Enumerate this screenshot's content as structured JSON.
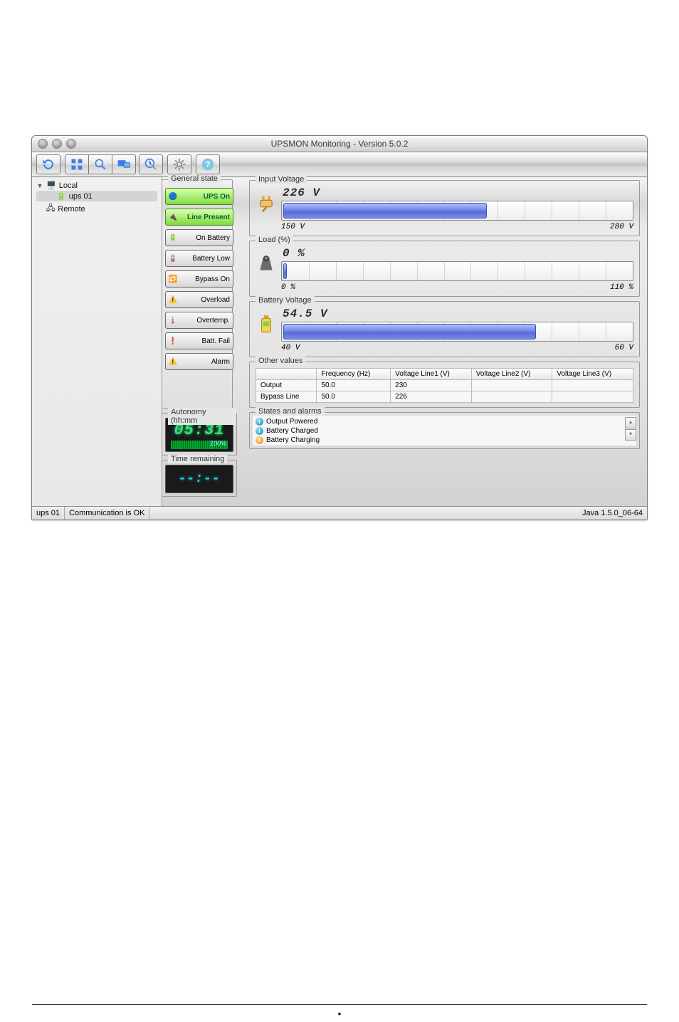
{
  "window": {
    "title": "UPSMON Monitoring - Version 5.0.2"
  },
  "tree": {
    "root1": "Local",
    "child1": "ups 01",
    "root2": "Remote"
  },
  "general_state": {
    "legend": "General state",
    "items": [
      {
        "label": "UPS On",
        "on": true
      },
      {
        "label": "Line Present",
        "on": true
      },
      {
        "label": "On Battery",
        "on": false
      },
      {
        "label": "Battery Low",
        "on": false
      },
      {
        "label": "Bypass On",
        "on": false
      },
      {
        "label": "Overload",
        "on": false
      },
      {
        "label": "Overtemp.",
        "on": false
      },
      {
        "label": "Batt. Fail",
        "on": false
      },
      {
        "label": "Alarm",
        "on": false
      }
    ]
  },
  "gauges": {
    "input_voltage": {
      "legend": "Input Voltage",
      "value": "226 V",
      "min": "150 V",
      "max": "280 V",
      "fill_pct": 58
    },
    "load": {
      "legend": "Load (%)",
      "value": "0 %",
      "min": "0 %",
      "max": "110 %",
      "fill_pct": 1
    },
    "batt_voltage": {
      "legend": "Battery Voltage",
      "value": "54.5 V",
      "min": "40 V",
      "max": "60 V",
      "fill_pct": 72
    }
  },
  "autonomy": {
    "legend": "Autonomy (hh:mm",
    "time": "05:31",
    "percent": "100%"
  },
  "time_remaining": {
    "legend": "Time remaining",
    "value": "--:--"
  },
  "other_values": {
    "legend": "Other values",
    "headers": [
      "",
      "Frequency (Hz)",
      "Voltage Line1 (V)",
      "Voltage Line2 (V)",
      "Voltage Line3 (V)"
    ],
    "rows": [
      {
        "name": "Output",
        "freq": "50.0",
        "l1": "230",
        "l2": "",
        "l3": ""
      },
      {
        "name": "Bypass Line",
        "freq": "50.0",
        "l1": "226",
        "l2": "",
        "l3": ""
      }
    ]
  },
  "states_alarms": {
    "legend": "States and alarms",
    "items": [
      {
        "kind": "info",
        "text": "Output Powered"
      },
      {
        "kind": "info",
        "text": "Battery Charged"
      },
      {
        "kind": "warn",
        "text": "Battery Charging"
      }
    ]
  },
  "statusbar": {
    "left1": "ups 01",
    "left2": "Communication is OK",
    "right": "Java 1.5.0_06-64"
  }
}
